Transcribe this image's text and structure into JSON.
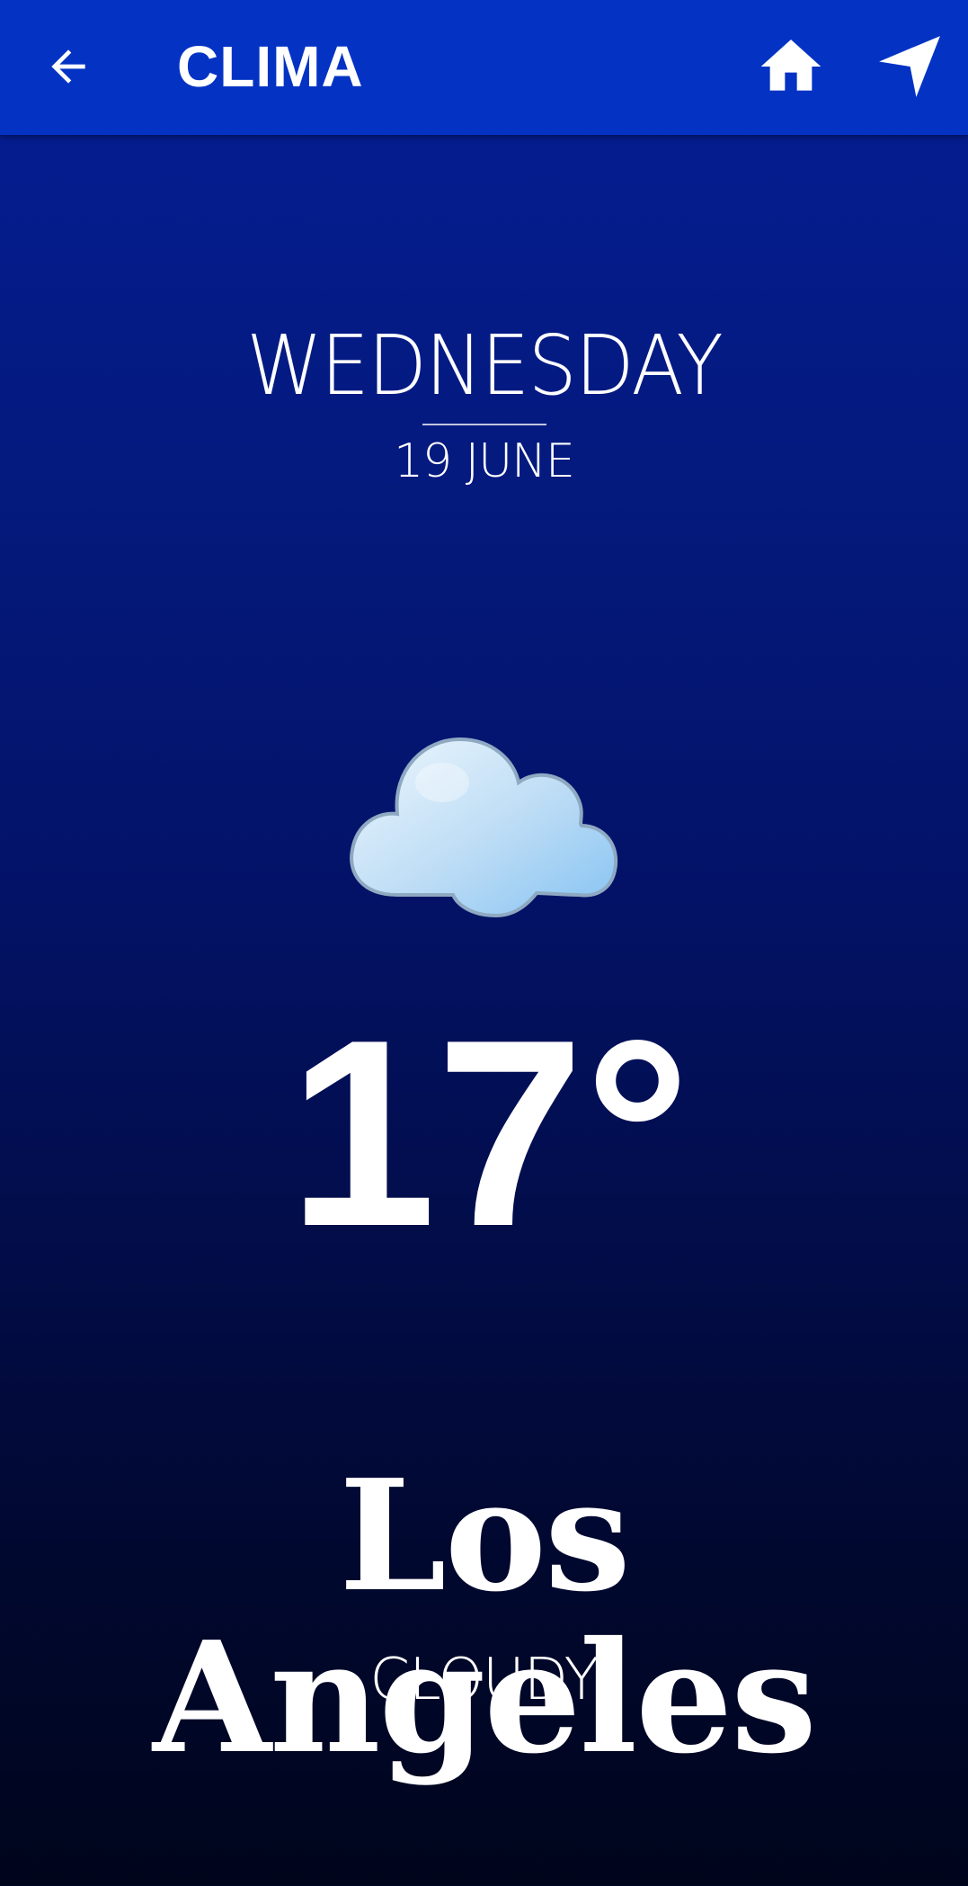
{
  "app_bar": {
    "title": "CLIMA",
    "back_icon": "arrow-left-icon",
    "home_icon": "home-icon",
    "navigation_icon": "navigation-arrow-icon",
    "background_color": "#0433c4"
  },
  "weather": {
    "day": "WEDNESDAY",
    "date": "19 JUNE",
    "condition_icon": "cloud-icon",
    "temperature": "17°",
    "city": "Los Angeles",
    "condition": "CLOUDY"
  },
  "colors": {
    "gradient_top": "#051d96",
    "gradient_bottom": "#00051c",
    "text": "#ffffff",
    "cloud_light": "#e6f3fc",
    "cloud_dark": "#8ec8f6"
  }
}
